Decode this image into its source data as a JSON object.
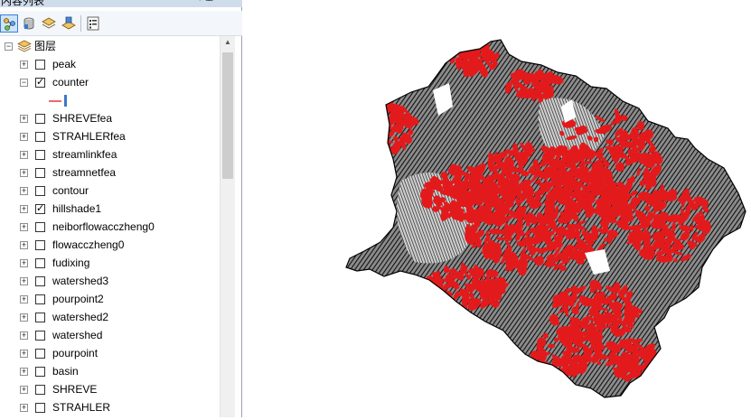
{
  "panel": {
    "title": "内容列表",
    "pin_glyph": "ᵻ",
    "close_glyph": "×"
  },
  "toolbar": {
    "buttons": [
      {
        "name": "list-by-drawing-order",
        "icon": "drawing-order-icon",
        "active": true
      },
      {
        "name": "list-by-source",
        "icon": "source-icon",
        "active": false
      },
      {
        "name": "list-by-visibility",
        "icon": "visibility-icon",
        "active": false
      },
      {
        "name": "list-by-selection",
        "icon": "selection-icon",
        "active": false
      },
      {
        "name": "options",
        "icon": "options-icon",
        "active": false
      }
    ]
  },
  "tree": {
    "root": {
      "label": "图层",
      "expanded": true
    },
    "layers": [
      {
        "label": "peak",
        "checked": false,
        "expanded": false
      },
      {
        "label": "counter",
        "checked": true,
        "expanded": true
      },
      {
        "label": "SHREVEfea",
        "checked": false,
        "expanded": false
      },
      {
        "label": "STRAHLERfea",
        "checked": false,
        "expanded": false
      },
      {
        "label": "streamlinkfea",
        "checked": false,
        "expanded": false
      },
      {
        "label": "streamnetfea",
        "checked": false,
        "expanded": false
      },
      {
        "label": "contour",
        "checked": false,
        "expanded": false
      },
      {
        "label": "hillshade1",
        "checked": true,
        "expanded": false
      },
      {
        "label": "neiborflowacczheng0",
        "checked": false,
        "expanded": false
      },
      {
        "label": "flowacczheng0",
        "checked": false,
        "expanded": false
      },
      {
        "label": "fudixing",
        "checked": false,
        "expanded": false
      },
      {
        "label": "watershed3",
        "checked": false,
        "expanded": false
      },
      {
        "label": "pourpoint2",
        "checked": false,
        "expanded": false
      },
      {
        "label": "watershed2",
        "checked": false,
        "expanded": false
      },
      {
        "label": "watershed",
        "checked": false,
        "expanded": false
      },
      {
        "label": "pourpoint",
        "checked": false,
        "expanded": false
      },
      {
        "label": "basin",
        "checked": false,
        "expanded": false
      },
      {
        "label": "SHREVE",
        "checked": false,
        "expanded": false
      },
      {
        "label": "STRAHLER",
        "checked": false,
        "expanded": false
      }
    ]
  },
  "colors": {
    "contour_line": "#e31a1c",
    "hillshade_dark": "#111111",
    "hillshade_light": "#9a9a9a",
    "panel_title_bg": "#cfdcec"
  }
}
